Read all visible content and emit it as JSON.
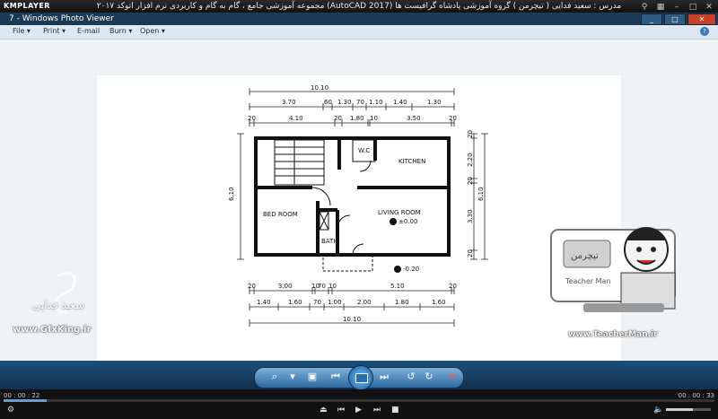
{
  "kmplayer": {
    "logo": "KMPLAYER",
    "caption": "مجموعه آموزشی جامع ، گام به گام و کاربردی نرم افزار  اتوکد ۲۰۱۷ (AutoCAD 2017)  مدرس : سعید فدایی ( تیچرمن ) گروه آموزشی پادشاه گرافیست ها",
    "time_current": "00 : 00 : 22",
    "time_total": "00 : 00 : 33"
  },
  "viewer": {
    "title": "7 - Windows Photo Viewer",
    "menu": [
      {
        "label": "File"
      },
      {
        "label": "Print"
      },
      {
        "label": "E-mail"
      },
      {
        "label": "Burn"
      },
      {
        "label": "Open"
      }
    ]
  },
  "plan": {
    "dims_top": [
      "10.10",
      "3.70",
      "60",
      "1.30",
      "70",
      "1.10",
      "1.40",
      "1.30",
      "20",
      "4.10",
      "20",
      "1.80",
      "10",
      "3.50",
      "20"
    ],
    "dims_bottom": [
      "20",
      "3.00",
      "10",
      "70",
      "10",
      "5.10",
      "20",
      "1.40",
      "1.60",
      "70",
      "1.00",
      "2.00",
      "1.80",
      "1.60",
      "10.10"
    ],
    "dims_left": [
      "6.10"
    ],
    "dims_right": [
      "20",
      "2.20",
      "20",
      "3.30",
      "20",
      "6.10"
    ],
    "rooms": [
      "W.C",
      "KITCHEN",
      "BED ROOM",
      "LIVING ROOM",
      "BATH"
    ],
    "levels": [
      "±0.00",
      "-0.20"
    ]
  },
  "overlays": {
    "left_name": "سعید فدایی",
    "left_url": "www.GfxKing.ir",
    "right_url": "www.TeacherMan.ir",
    "right_logo_text": "تیچرمن",
    "right_logo_sub": "Teacher Man"
  }
}
